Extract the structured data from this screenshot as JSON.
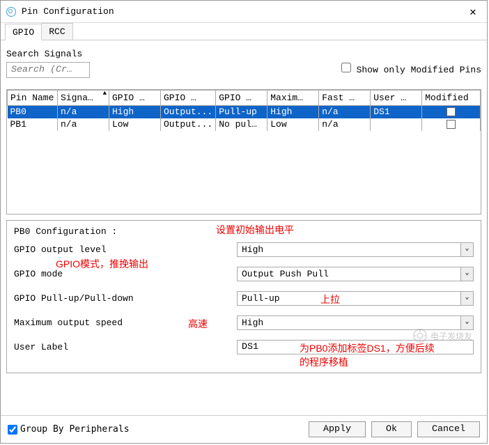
{
  "window": {
    "title": "Pin Configuration"
  },
  "tabs": {
    "gpio": "GPIO",
    "rcc": "RCC"
  },
  "search": {
    "label": "Search Signals",
    "placeholder": "Search (Cr…",
    "show_modified_label": "Show only Modified Pins"
  },
  "table": {
    "headers": {
      "pin_name": "Pin Name",
      "signal": "Signa…",
      "gpio1": "GPIO …",
      "gpio2": "GPIO …",
      "gpio3": "GPIO …",
      "maxim": "Maxim…",
      "fast": "Fast …",
      "user": "User …",
      "modified": "Modified"
    },
    "rows": [
      {
        "pin": "PB0",
        "signal": "n/a",
        "g1": "High",
        "g2": "Output...",
        "g3": "Pull-up",
        "max": "High",
        "fast": "n/a",
        "user": "DS1",
        "mod": "✓",
        "selected": true
      },
      {
        "pin": "PB1",
        "signal": "n/a",
        "g1": "Low",
        "g2": "Output...",
        "g3": "No pul…",
        "max": "Low",
        "fast": "n/a",
        "user": "",
        "mod": "",
        "selected": false
      }
    ]
  },
  "config": {
    "title": "PB0 Configuration :",
    "fields": {
      "output_level": {
        "label": "GPIO output level",
        "value": "High"
      },
      "mode": {
        "label": "GPIO mode",
        "value": "Output Push Pull"
      },
      "pull": {
        "label": "GPIO Pull-up/Pull-down",
        "value": "Pull-up"
      },
      "speed": {
        "label": "Maximum output speed",
        "value": "High"
      },
      "user_label": {
        "label": "User Label",
        "value": "DS1"
      }
    }
  },
  "annotations": {
    "a1": "设置初始输出电平",
    "a2": "GPIO模式，推挽输出",
    "a3": "上拉",
    "a4": "高速",
    "a5_line1": "为PB0添加标签DS1，方便后续",
    "a5_line2": "的程序移植"
  },
  "footer": {
    "group_label": "Group By Peripherals",
    "apply": "Apply",
    "ok": "Ok",
    "cancel": "Cancel"
  },
  "watermark": "电子发烧友"
}
